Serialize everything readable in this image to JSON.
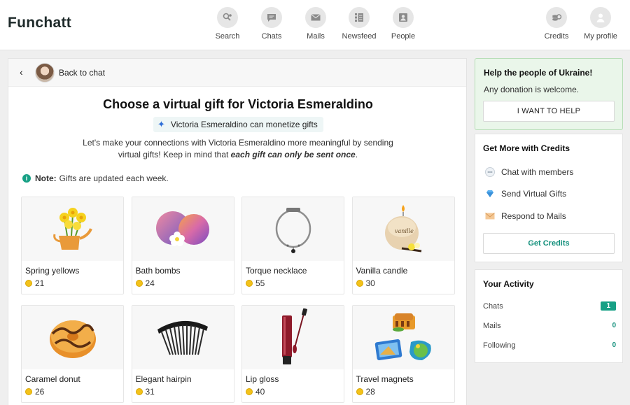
{
  "app": {
    "logo": "Funchatt"
  },
  "nav": {
    "items": [
      {
        "label": "Search",
        "icon": "search-icon"
      },
      {
        "label": "Chats",
        "icon": "chat-icon"
      },
      {
        "label": "Mails",
        "icon": "mail-icon"
      },
      {
        "label": "Newsfeed",
        "icon": "newsfeed-icon"
      },
      {
        "label": "People",
        "icon": "people-icon"
      }
    ],
    "right": [
      {
        "label": "Credits",
        "icon": "coins-icon"
      },
      {
        "label": "My profile",
        "icon": "profile-icon"
      }
    ]
  },
  "back": {
    "label": "Back to chat"
  },
  "main": {
    "title": "Choose a virtual gift for Victoria Esmeraldino",
    "monetize": "Victoria Esmeraldino can monetize gifts",
    "intro_plain": "Let's make your connections with Victoria Esmeraldino more meaningful by sending virtual gifts! Keep in mind that ",
    "intro_emphasis": "each gift can only be sent once",
    "intro_end": ".",
    "note_label": "Note:",
    "note_text": "Gifts are updated each week."
  },
  "gifts": [
    {
      "name": "Spring yellows",
      "price": "21",
      "icon": "daffodils-icon"
    },
    {
      "name": "Bath bombs",
      "price": "24",
      "icon": "bath-bombs-icon"
    },
    {
      "name": "Torque necklace",
      "price": "55",
      "icon": "necklace-icon"
    },
    {
      "name": "Vanilla candle",
      "price": "30",
      "icon": "candle-icon"
    },
    {
      "name": "Caramel donut",
      "price": "26",
      "icon": "donut-icon"
    },
    {
      "name": "Elegant hairpin",
      "price": "31",
      "icon": "hairpin-icon"
    },
    {
      "name": "Lip gloss",
      "price": "40",
      "icon": "lip-gloss-icon"
    },
    {
      "name": "Travel magnets",
      "price": "28",
      "icon": "magnets-icon"
    }
  ],
  "ukraine": {
    "title": "Help the people of Ukraine!",
    "text": "Any donation is welcome.",
    "button": "I WANT TO HELP"
  },
  "credits_box": {
    "title": "Get More with Credits",
    "perks": [
      {
        "label": "Chat with members",
        "icon": "chat-bubble-icon"
      },
      {
        "label": "Send Virtual Gifts",
        "icon": "diamond-icon"
      },
      {
        "label": "Respond to Mails",
        "icon": "envelope-icon"
      }
    ],
    "button": "Get Credits"
  },
  "activity": {
    "title": "Your Activity",
    "rows": [
      {
        "label": "Chats",
        "count": "1"
      },
      {
        "label": "Mails",
        "count": "0"
      },
      {
        "label": "Following",
        "count": "0"
      }
    ]
  },
  "colors": {
    "accent": "#17a085",
    "coin": "#f3c21a",
    "ukraine_bg": "#eaf6ea"
  }
}
